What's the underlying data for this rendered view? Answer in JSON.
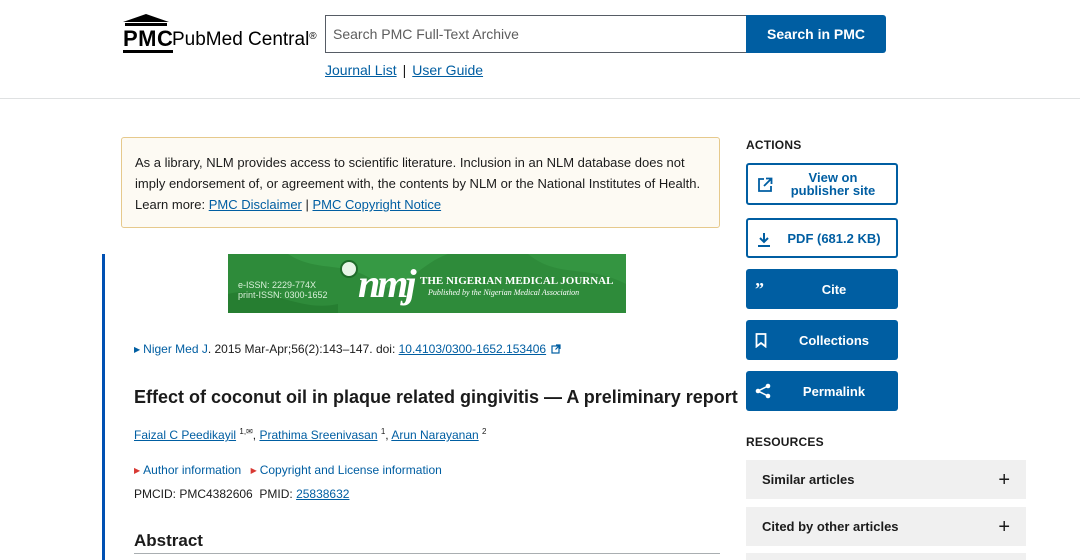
{
  "header": {
    "logo_abbr": "PMC",
    "logo_name": "PubMed Central",
    "logo_reg": "®",
    "search_placeholder": "Search PMC Full-Text Archive",
    "search_button": "Search in PMC",
    "links": [
      "Journal List",
      "User Guide"
    ],
    "link_separator": "|"
  },
  "disclaimer": {
    "text": "As a library, NLM provides access to scientific literature. Inclusion in an NLM database does not imply endorsement of, or agreement with, the contents by NLM or the National Institutes of Health. Learn more: ",
    "link1": "PMC Disclaimer",
    "separator": " | ",
    "link2": "PMC Copyright Notice"
  },
  "banner": {
    "eissn": "e-ISSN: 2229-774X",
    "pissn": "print-ISSN: 0300-1652",
    "mark": "nmj",
    "journal_name": "THE NIGERIAN MEDICAL JOURNAL",
    "journal_sub": "Published by the Nigerian Medical Association"
  },
  "article": {
    "journal_link": "Niger Med J",
    "citation_text": ". 2015 Mar-Apr;56(2):143–147. doi: ",
    "doi": "10.4103/0300-1652.153406",
    "title": "Effect of coconut oil in plaque related gingivitis — A preliminary report",
    "authors": [
      {
        "name": "Faizal C Peedikayil",
        "sup": "1,✉"
      },
      {
        "name": "Prathima Sreenivasan",
        "sup": "1"
      },
      {
        "name": "Arun Narayanan",
        "sup": "2"
      }
    ],
    "author_info": "Author information",
    "copyright_info": "Copyright and License information",
    "pmcid_label": "PMCID: PMC4382606",
    "pmid_label": "PMID: ",
    "pmid": "25838632",
    "abstract_heading": "Abstract"
  },
  "sidebar": {
    "actions_heading": "ACTIONS",
    "view_publisher": "View on publisher site",
    "pdf": "PDF (681.2 KB)",
    "cite": "Cite",
    "collections": "Collections",
    "permalink": "Permalink",
    "resources_heading": "RESOURCES",
    "resources": [
      {
        "label": "Similar articles",
        "toggle": "+"
      },
      {
        "label": "Cited by other articles",
        "toggle": "+"
      }
    ]
  },
  "colors": {
    "primary": "#005ea2",
    "disclaimer_border": "#e6c98c",
    "banner_green": "#2e8b3a",
    "article_bar": "#0050b3"
  }
}
